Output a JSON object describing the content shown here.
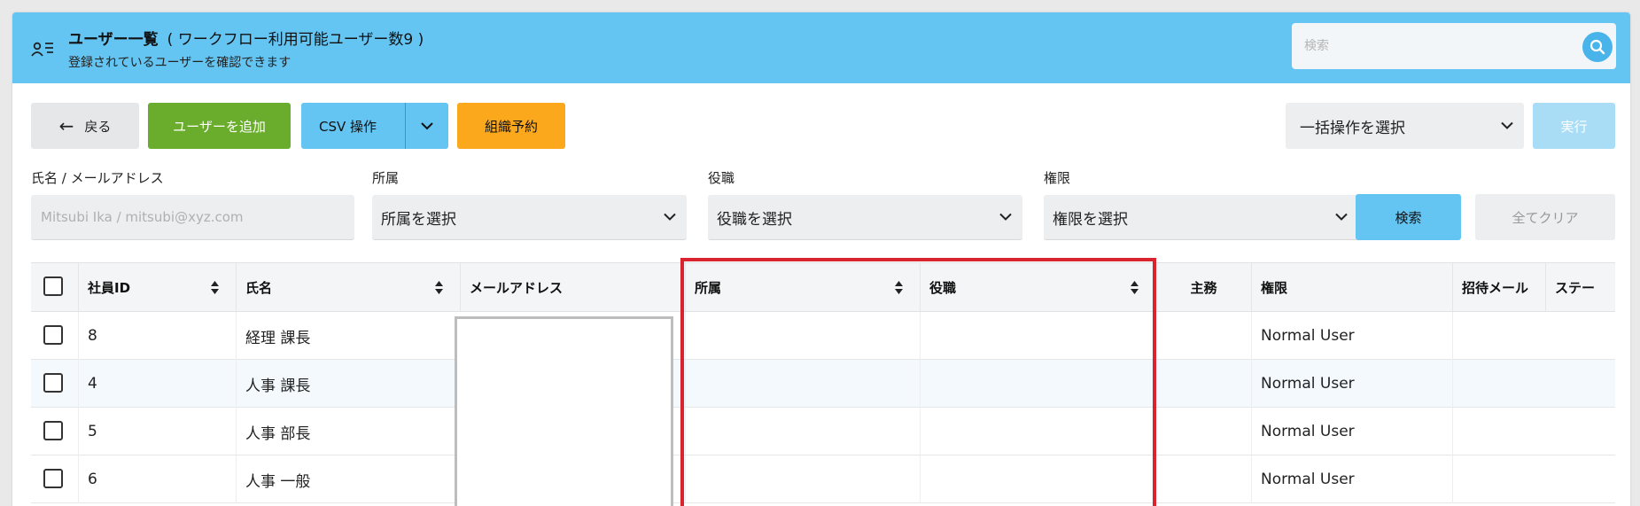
{
  "header": {
    "title": "ユーザー一覧",
    "subtitle": "( ワークフロー利用可能ユーザー数9 )",
    "description": "登録されているユーザーを確認できます",
    "search_placeholder": "検索",
    "search_icon": "magnifier-icon",
    "user_list_icon": "user-list-icon"
  },
  "toolbar": {
    "back_label": "戻る",
    "add_user_label": "ユーザーを追加",
    "csv_label": "CSV 操作",
    "org_reserve_label": "組織予約",
    "bulk_select_label": "一括操作を選択",
    "execute_label": "実行"
  },
  "filters": {
    "name_email_label": "氏名 / メールアドレス",
    "name_email_placeholder": "Mitsubi Ika / mitsubi@xyz.com",
    "dept_label": "所属",
    "dept_placeholder": "所属を選択",
    "position_label": "役職",
    "position_placeholder": "役職を選択",
    "permission_label": "権限",
    "permission_placeholder": "権限を選択",
    "search_button": "検索",
    "clear_button": "全てクリア"
  },
  "table": {
    "columns": [
      "社員ID",
      "氏名",
      "メールアドレス",
      "所属",
      "役職",
      "主務",
      "権限",
      "招待メール",
      "ステー"
    ],
    "rows": [
      {
        "id": "8",
        "name": "経理 課長",
        "permission": "Normal User"
      },
      {
        "id": "4",
        "name": "人事 課長",
        "permission": "Normal User"
      },
      {
        "id": "5",
        "name": "人事 部長",
        "permission": "Normal User"
      },
      {
        "id": "6",
        "name": "人事 一般",
        "permission": "Normal User"
      }
    ]
  },
  "colors": {
    "header_bg": "#64c4f2",
    "add_button": "#6aad2d",
    "org_button": "#fba81d",
    "highlight_border": "#d9232e"
  }
}
